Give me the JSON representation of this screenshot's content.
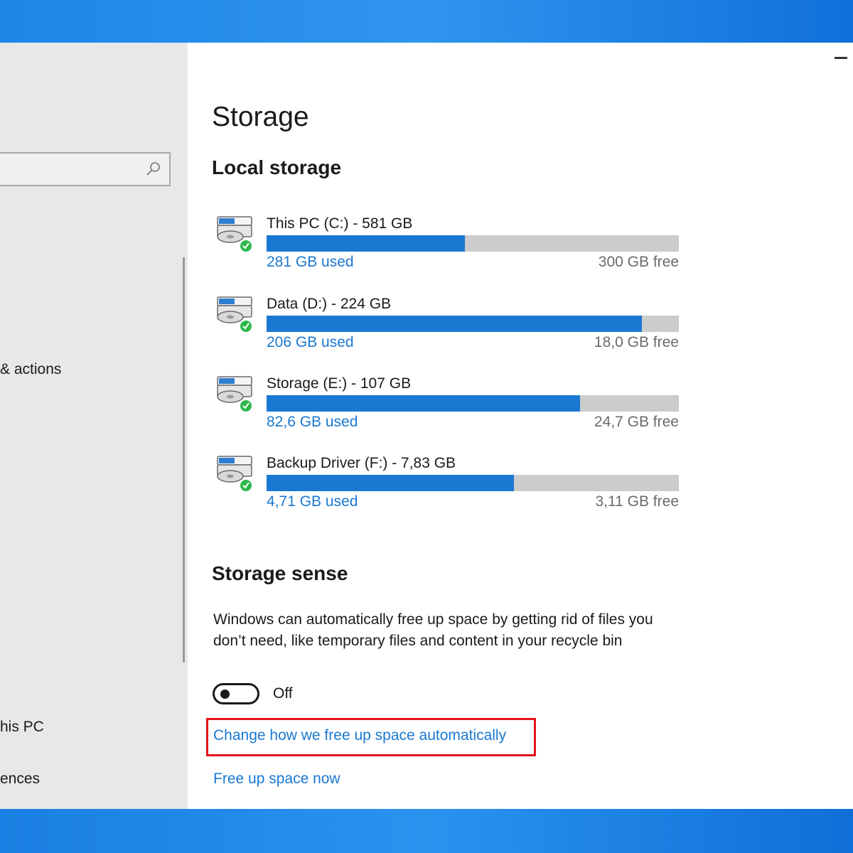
{
  "window": {
    "minimize_label": "Minimize"
  },
  "sidebar": {
    "search": {
      "placeholder": ""
    },
    "partial_items": [
      {
        "label": "& actions"
      },
      {
        "label": "his PC"
      },
      {
        "label": "ences"
      }
    ]
  },
  "page": {
    "title": "Storage"
  },
  "local_storage": {
    "heading": "Local storage",
    "drives": [
      {
        "name": "This PC (C:) - 581 GB",
        "used": "281 GB used",
        "free": "300 GB free",
        "used_fraction": 0.481
      },
      {
        "name": "Data (D:) - 224 GB",
        "used": "206 GB used",
        "free": "18,0 GB free",
        "used_fraction": 0.91
      },
      {
        "name": "Storage (E:) - 107 GB",
        "used": "82,6 GB used",
        "free": "24,7 GB free",
        "used_fraction": 0.76
      },
      {
        "name": "Backup Driver (F:) - 7,83 GB",
        "used": "4,71 GB used",
        "free": "3,11 GB free",
        "used_fraction": 0.6
      }
    ]
  },
  "storage_sense": {
    "heading": "Storage sense",
    "description": "Windows can automatically free up space by getting rid of files you don’t need, like temporary files and content in your recycle bin",
    "toggle": {
      "state": "Off"
    },
    "change_link": "Change how we free up space automatically",
    "free_now_link": "Free up space now"
  },
  "colors": {
    "accent": "#1a78d2",
    "bar_track": "#cccccc",
    "highlight": "#e2131b",
    "drive_ok": "#2db84b"
  },
  "icons": {
    "drive": "hard-drive-icon",
    "drive_status": "checkmark-icon",
    "search": "search-icon"
  }
}
